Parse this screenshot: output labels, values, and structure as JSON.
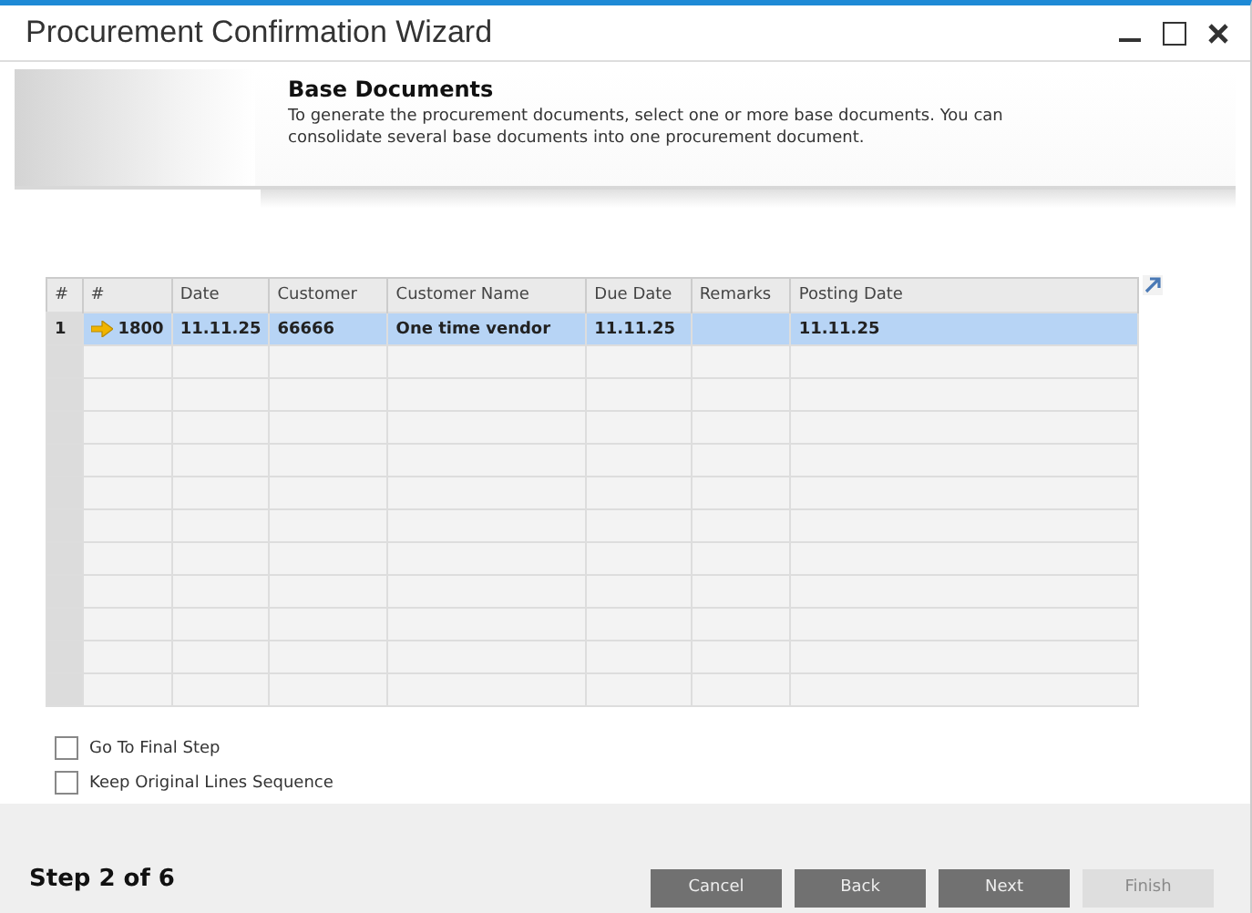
{
  "window": {
    "title": "Procurement Confirmation Wizard"
  },
  "header": {
    "title": "Base Documents",
    "description": "To generate the procurement documents, select one or more base documents. You can consolidate several base documents into one procurement document."
  },
  "table": {
    "columns": [
      "#",
      "#",
      "Date",
      "Customer",
      "Customer Name",
      "Due Date",
      "Remarks",
      "Posting Date"
    ],
    "rows": [
      {
        "cells": [
          "1",
          "1800",
          "11.11.25",
          "66666",
          "One time vendor",
          "11.11.25",
          "",
          "11.11.25"
        ],
        "selected": true
      }
    ]
  },
  "options": [
    {
      "label": "Go To Final Step",
      "checked": false
    },
    {
      "label": "Keep Original Lines Sequence",
      "checked": false
    }
  ],
  "footer": {
    "step": "Step 2 of 6",
    "buttons": [
      {
        "label": "Cancel",
        "disabled": false
      },
      {
        "label": "Back",
        "disabled": false
      },
      {
        "label": "Next",
        "disabled": false
      },
      {
        "label": "Finish",
        "disabled": true
      }
    ]
  }
}
